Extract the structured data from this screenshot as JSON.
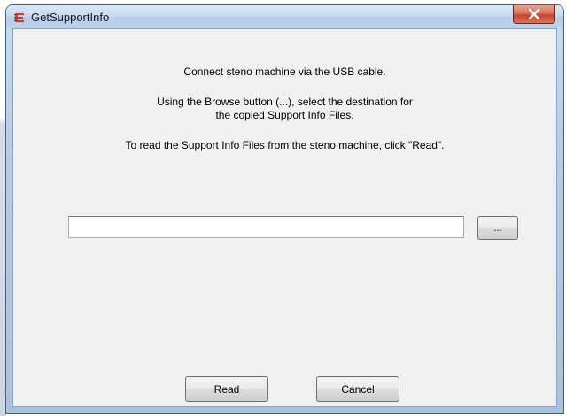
{
  "window": {
    "title": "GetSupportInfo"
  },
  "messages": {
    "line1": "Connect steno machine via the USB cable.",
    "line2a": "Using the Browse button (...), select the destination for",
    "line2b": "the copied Support Info Files.",
    "line3": "To read the Support Info Files from the steno machine, click \"Read\"."
  },
  "destination": {
    "value": "",
    "placeholder": ""
  },
  "buttons": {
    "browse_label": "...",
    "read_label": "Read",
    "cancel_label": "Cancel"
  },
  "icons": {
    "app": "app-logo-icon",
    "close": "close-icon"
  },
  "colors": {
    "title_bar": "#c5d8ee",
    "close_button": "#c4432c",
    "client_bg": "#f0f0f0",
    "app_icon": "#e03a2b"
  }
}
